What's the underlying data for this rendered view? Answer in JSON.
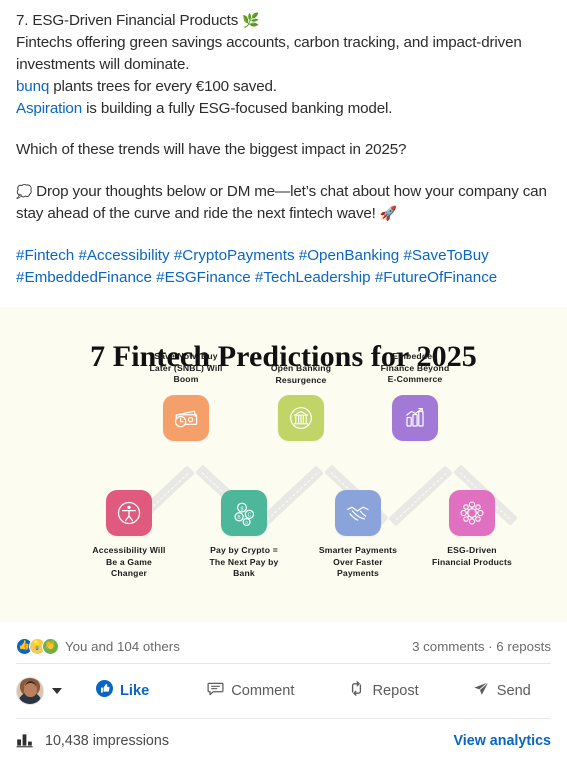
{
  "post": {
    "lines": [
      {
        "id": "l1",
        "text": "7. ESG-Driven Financial Products",
        "emoji": "🌿"
      },
      {
        "id": "l2",
        "text": "Fintechs offering green savings accounts, carbon tracking, and impact-driven investments will dominate."
      },
      {
        "id": "l3",
        "link": "bunq",
        "text": " plants trees for every €100 saved."
      },
      {
        "id": "l4",
        "link": "Aspiration",
        "text": " is building a fully ESG-focused banking model."
      },
      {
        "id": "l5",
        "text": "Which of these trends will have the biggest impact in 2025?"
      },
      {
        "id": "l6",
        "emoji": "💭",
        "text": "Drop your thoughts below or DM me—let’s chat about how your company can stay ahead of the curve and ride the next fintech wave!",
        "trailing_emoji": "🚀"
      }
    ],
    "hashtags_line1": "#Fintech #Accessibility #CryptoPayments #OpenBanking #SaveToBuy",
    "hashtags_line2": "#EmbeddedFinance #ESGFinance #TechLeadership #FutureOfFinance"
  },
  "infographic": {
    "title": "7 Fintech Predictions for 2025",
    "background": "#fcfdf0",
    "connector_color": "#e8e8e4",
    "nodes": [
      {
        "label": "Accessibility Will\nBe a Game\nChanger",
        "position": "bottom",
        "color": "#e05a7d",
        "icon": "accessibility-icon"
      },
      {
        "label": "Save Now, Buy\nLater (SNBL) Will\nBoom",
        "position": "top",
        "color": "#f5a06a",
        "icon": "wallet-clock-icon"
      },
      {
        "label": "Pay by Crypto =\nThe Next Pay by\nBank",
        "position": "bottom",
        "color": "#4cb79a",
        "icon": "coins-icon"
      },
      {
        "label": "Open Banking\nResurgence",
        "position": "top",
        "color": "#c0d468",
        "icon": "bank-icon"
      },
      {
        "label": "Smarter Payments\nOver Faster\nPayments",
        "position": "bottom",
        "color": "#8aa4db",
        "icon": "handshake-icon"
      },
      {
        "label": "Embedded\nFinance Beyond\nE-Commerce",
        "position": "top",
        "color": "#a379d8",
        "icon": "growth-chart-icon"
      },
      {
        "label": "ESG-Driven\nFinancial Products",
        "position": "bottom",
        "color": "#e070c0",
        "icon": "esg-network-icon"
      }
    ]
  },
  "social": {
    "reactions": [
      {
        "name": "like-reaction",
        "glyph": "👍",
        "color": "#0a66c2"
      },
      {
        "name": "insightful-reaction",
        "glyph": "💡",
        "color": "#f5c75d"
      },
      {
        "name": "support-reaction",
        "glyph": "👏",
        "color": "#6fae4f"
      }
    ],
    "reaction_text": "You and 104 others",
    "comments_reposts": "3 comments · 6 reposts"
  },
  "actions": {
    "like": "Like",
    "comment": "Comment",
    "repost": "Repost",
    "send": "Send"
  },
  "analytics": {
    "impressions": "10,438 impressions",
    "view_link": "View analytics"
  },
  "colors": {
    "linkedin_blue": "#0a66c2",
    "text_primary": "#2c2c2c",
    "text_muted": "#6a6a6a"
  }
}
